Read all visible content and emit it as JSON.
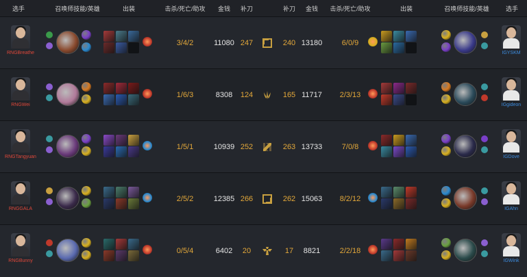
{
  "headers": {
    "player": "选手",
    "spells_champ": "召唤师技能/英雄",
    "items": "出装",
    "kda": "击杀/死亡/助攻",
    "gold": "金钱",
    "cs": "补刀"
  },
  "rows": [
    {
      "left": {
        "name": "RNGBreathe",
        "kda": "3/4/2",
        "gold": "11080",
        "cs": "247",
        "runes": [
          "#3a9a4a",
          "#8a5fd0"
        ],
        "champ": "#8a4a2e",
        "spells": [
          "#7a3fc8",
          "#2a8ad0"
        ],
        "items": [
          "#a33a3a",
          "#4a7a8a",
          "#3a6a9a",
          "#6a2a2a",
          "#3a5aa0",
          "#111316"
        ],
        "trinket": "#c0392b"
      },
      "role_icon": "top-lane-icon",
      "right": {
        "name": "IGYSKM",
        "kda": "6/0/9",
        "gold": "13180",
        "cs": "240",
        "runes": [
          "#c8a040",
          "#3a9aa0"
        ],
        "champ": "#3a3a8a",
        "spells": [
          "#d8b020",
          "#7a3fc8"
        ],
        "items": [
          "#c89a20",
          "#3a8aa0",
          "#3a6ab0",
          "#6a9a40",
          "#2a6aa0",
          "#111316"
        ],
        "trinket": "#d8b020"
      }
    },
    {
      "left": {
        "name": "RNGWei",
        "kda": "1/6/3",
        "gold": "8308",
        "cs": "124",
        "runes": [
          "#8a5fd0",
          "#3a9aa0"
        ],
        "champ": "#b07a9a",
        "spells": [
          "#d87a20",
          "#d8b020"
        ],
        "items": [
          "#8a2a2a",
          "#a02a3a",
          "#7a1a1a",
          "#3a6ab0",
          "#2a5ab0",
          "#3a6a7a"
        ],
        "trinket": "#c0392b"
      },
      "role_icon": "jungle-icon",
      "right": {
        "name": "IGgideon",
        "kda": "2/3/13",
        "gold": "11717",
        "cs": "165",
        "runes": [
          "#3a9aa0",
          "#c0392b"
        ],
        "champ": "#2a4a5a",
        "spells": [
          "#d87a20",
          "#d8b020"
        ],
        "items": [
          "#a33a3a",
          "#8a2a8a",
          "#7a2a2a",
          "#c03a2a",
          "#3a4a8a",
          "#111316"
        ],
        "trinket": "#c0392b"
      }
    },
    {
      "left": {
        "name": "RNGTangyuan",
        "kda": "1/5/1",
        "gold": "10939",
        "cs": "252",
        "runes": [
          "#3a9aa0",
          "#8a5fd0"
        ],
        "champ": "#6a3a7a",
        "spells": [
          "#7a3fc8",
          "#d8b020"
        ],
        "items": [
          "#8a4ac8",
          "#6a3a7a",
          "#c8a040",
          "#3a3a9a",
          "#2a6ab0",
          "#4a3a8a"
        ],
        "trinket": "#2a8ad0"
      },
      "role_icon": "mid-lane-icon",
      "right": {
        "name": "IGDove",
        "kda": "7/0/8",
        "gold": "13733",
        "cs": "263",
        "runes": [
          "#7a3fc8",
          "#3a9aa0"
        ],
        "champ": "#2a2a4a",
        "spells": [
          "#7a3fc8",
          "#d8b020"
        ],
        "items": [
          "#8a2a2a",
          "#c89a20",
          "#3a6ab0",
          "#3a8aa0",
          "#7a4ac8",
          "#2a5ab0"
        ],
        "trinket": "#c0392b"
      }
    },
    {
      "left": {
        "name": "RNGGALA",
        "kda": "2/5/2",
        "gold": "12385",
        "cs": "266",
        "runes": [
          "#c8a040",
          "#8a5fd0"
        ],
        "champ": "#3a2a4a",
        "spells": [
          "#d8b020",
          "#6aa040"
        ],
        "items": [
          "#3a6a8a",
          "#4a7a6a",
          "#7a5a9a",
          "#2a3a6a",
          "#8a3a2a",
          "#6a7a3a"
        ],
        "trinket": "#2a8ad0"
      },
      "role_icon": "bot-lane-icon",
      "right": {
        "name": "IGAhn",
        "kda": "8/2/12",
        "gold": "15063",
        "cs": "262",
        "runes": [
          "#3a9aa0",
          "#8a5fd0"
        ],
        "champ": "#7a3a2a",
        "spells": [
          "#2a8ad0",
          "#d8b020"
        ],
        "items": [
          "#3a6a8a",
          "#5a8a6a",
          "#c03a2a",
          "#2a3a6a",
          "#8a6a2a",
          "#7a2a2a"
        ],
        "trinket": "#2a8ad0"
      }
    },
    {
      "left": {
        "name": "RNGBunny",
        "kda": "0/5/4",
        "gold": "6402",
        "cs": "20",
        "runes": [
          "#c0392b",
          "#3a9aa0"
        ],
        "champ": "#5a6ab0",
        "spells": [
          "#d8b020",
          "#d8b020"
        ],
        "items": [
          "#2a6a6a",
          "#a33a3a",
          "#3a6a8a",
          "#8a3a2a",
          "#5a3a6a",
          "#7a6a3a"
        ],
        "trinket": "#c0392b"
      },
      "role_icon": "support-icon",
      "right": {
        "name": "IGWink",
        "kda": "2/2/18",
        "gold": "8821",
        "cs": "17",
        "runes": [
          "#8a5fd0",
          "#3a9aa0"
        ],
        "champ": "#2a4a4a",
        "spells": [
          "#6aa040",
          "#d8b020"
        ],
        "items": [
          "#5a3a8a",
          "#8a2a2a",
          "#c07a20",
          "#3a6a8a",
          "#a33a3a",
          "#6a3a2a"
        ],
        "trinket": "#c0392b"
      }
    }
  ]
}
